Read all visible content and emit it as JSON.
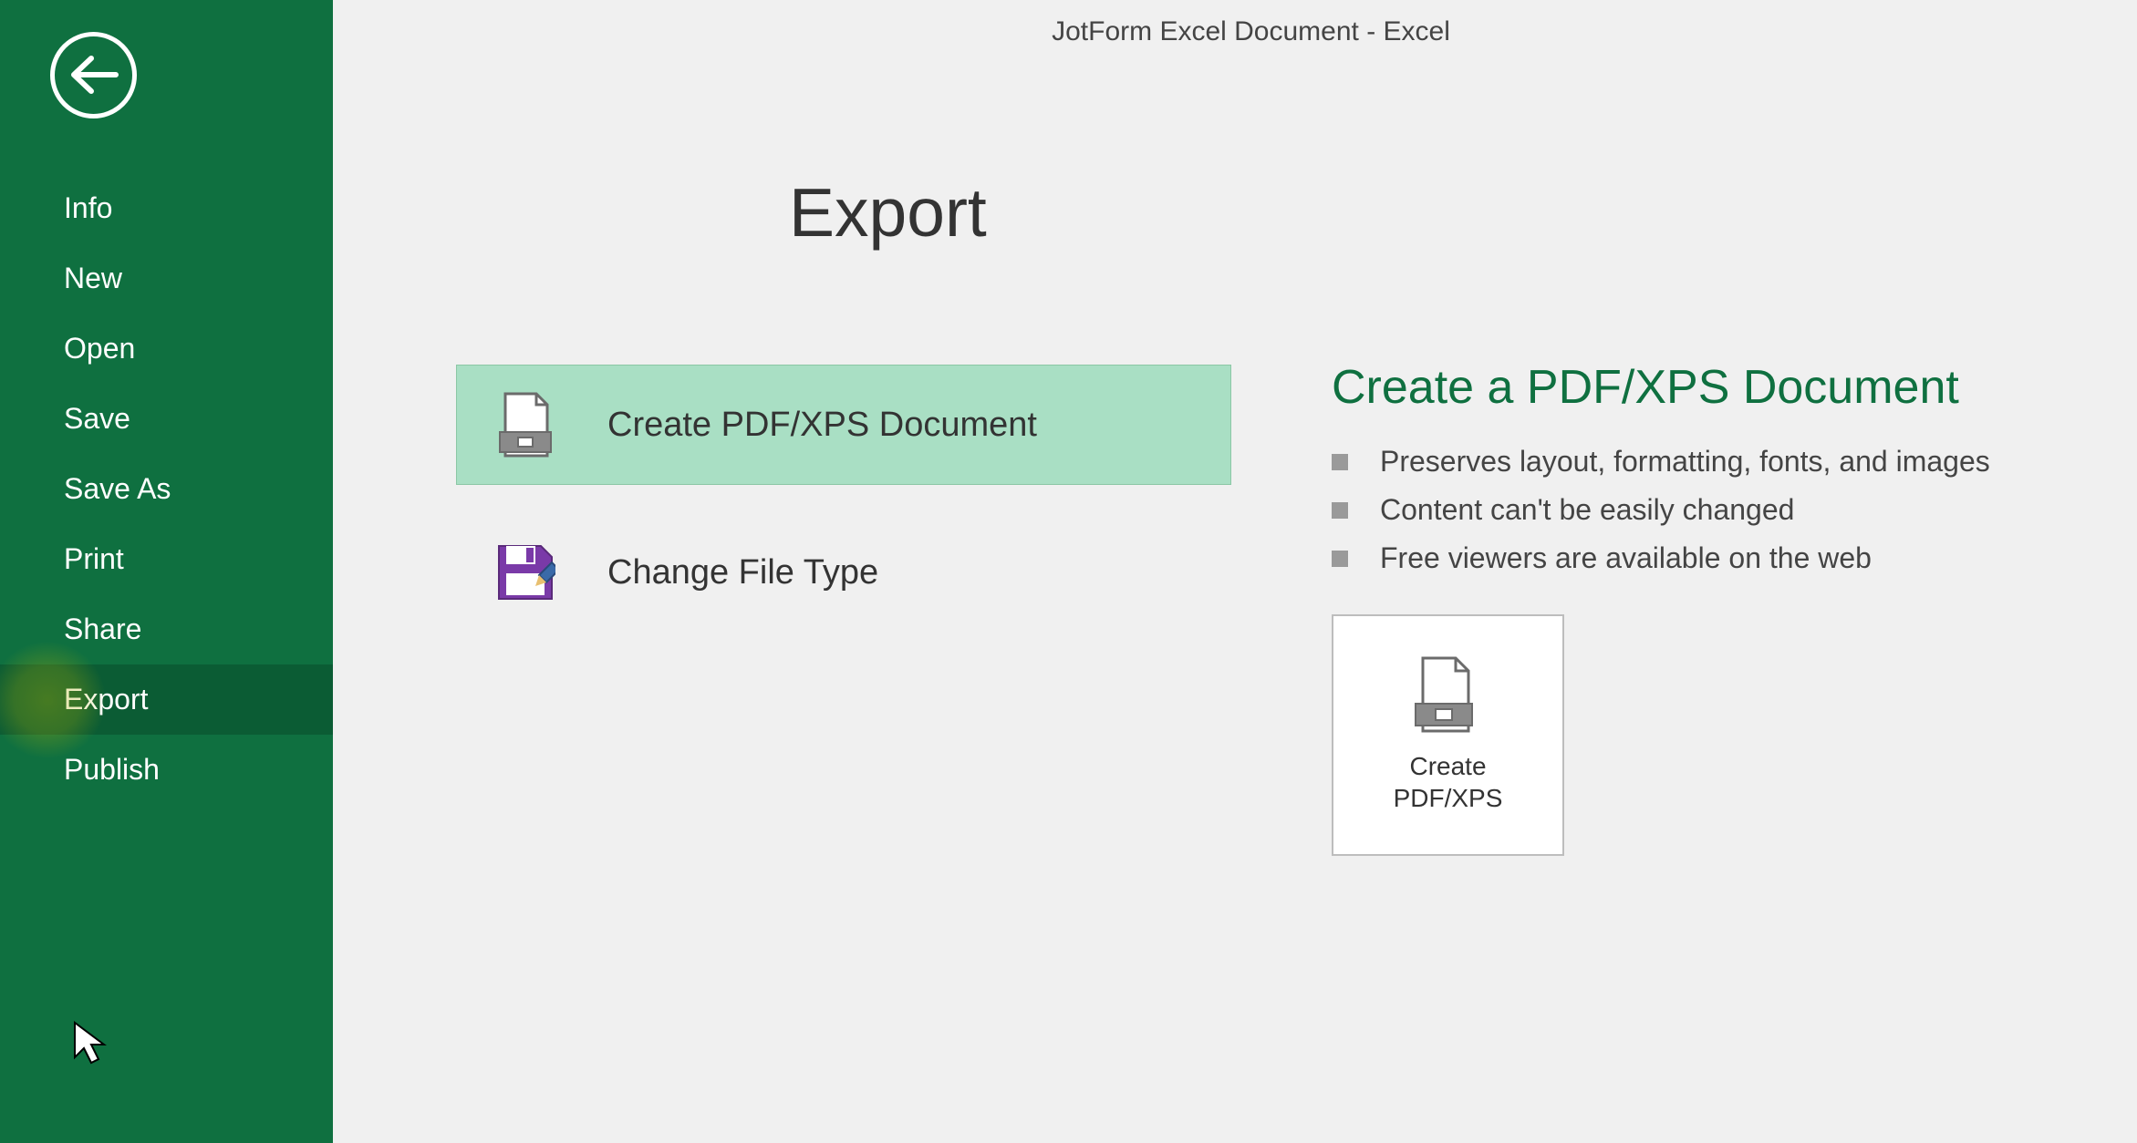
{
  "titlebar": {
    "text": "JotForm Excel Document - Excel"
  },
  "sidebar": {
    "items": [
      {
        "label": "Info"
      },
      {
        "label": "New"
      },
      {
        "label": "Open"
      },
      {
        "label": "Save"
      },
      {
        "label": "Save As"
      },
      {
        "label": "Print"
      },
      {
        "label": "Share"
      },
      {
        "label": "Export"
      },
      {
        "label": "Publish"
      }
    ],
    "active_index": 7
  },
  "page": {
    "heading": "Export",
    "options": [
      {
        "label": "Create PDF/XPS Document",
        "icon": "pdf-doc-icon",
        "selected": true
      },
      {
        "label": "Change File Type",
        "icon": "save-type-icon",
        "selected": false
      }
    ],
    "detail": {
      "title": "Create a PDF/XPS Document",
      "bullets": [
        "Preserves layout, formatting, fonts, and images",
        "Content can't be easily changed",
        "Free viewers are available on the web"
      ],
      "action_button": {
        "label": "Create\nPDF/XPS"
      }
    }
  }
}
